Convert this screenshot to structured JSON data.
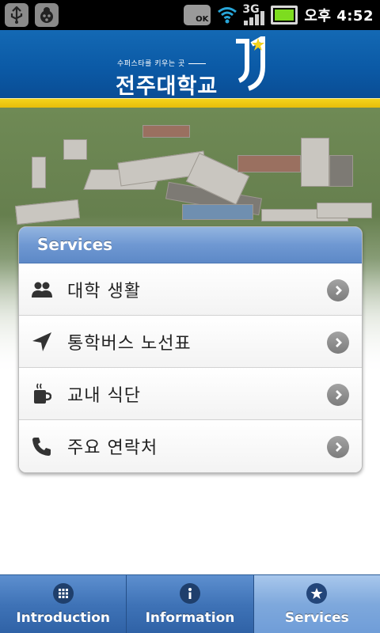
{
  "status_bar": {
    "ok_badge": "OK",
    "network": "3G",
    "battery_level": 1.0,
    "time": "오후 4:52"
  },
  "header": {
    "tagline": "수퍼스타를 키우는 곳",
    "title": "전주대학교",
    "logo_icon": "university-logo-icon"
  },
  "services": {
    "heading": "Services",
    "items": [
      {
        "label": "대학 생활",
        "icon": "people-icon"
      },
      {
        "label": "통학버스 노선표",
        "icon": "navigation-arrow-icon"
      },
      {
        "label": "교내 식단",
        "icon": "coffee-cup-icon"
      },
      {
        "label": "주요 연락처",
        "icon": "phone-icon"
      }
    ]
  },
  "tabbar": {
    "active_tab": "Services",
    "tabs": [
      {
        "label": "Introduction",
        "icon": "grid-icon"
      },
      {
        "label": "Information",
        "icon": "info-icon"
      },
      {
        "label": "Services",
        "icon": "star-icon"
      }
    ]
  },
  "colors": {
    "header_blue": "#0b5aa6",
    "accent_yellow": "#f3d21c",
    "tab_blue": "#3f73b7",
    "tab_active": "#7ea8dc"
  }
}
